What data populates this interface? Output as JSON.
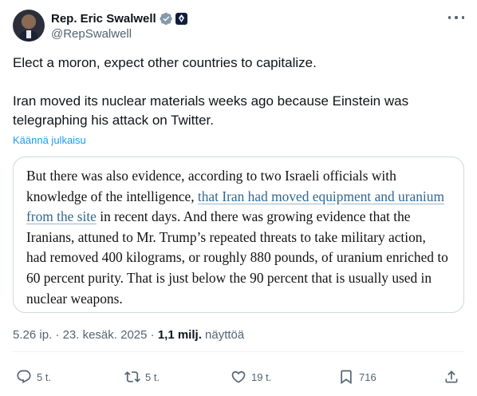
{
  "author": {
    "name": "Rep. Eric Swalwell",
    "handle": "@RepSwalwell"
  },
  "tweet": {
    "paragraph1": "Elect a moron, expect other countries to capitalize.",
    "paragraph2": "Iran moved its nuclear materials weeks ago because Einstein was telegraphing his attack on Twitter.",
    "translate_label": "Käännä julkaisu"
  },
  "quote": {
    "text_before": "But there was also evidence, according to two Israeli officials with knowledge of the intelligence, ",
    "link_text": "that Iran had moved equipment and uranium from the site",
    "text_after": " in recent days. And there was growing evidence that the Iranians, attuned to Mr. Trump’s repeated threats to take military action, had removed 400 kilograms, or roughly 880 pounds, of uranium enriched to 60 percent purity. That is just below the 90 percent that is usually used in nuclear weapons."
  },
  "meta": {
    "time": "5.26 ip.",
    "separator": "·",
    "date": "23. kesäk. 2025",
    "views": "1,1 milj.",
    "views_label": "näyttöä"
  },
  "actions": {
    "replies": "5 t.",
    "reposts": "5 t.",
    "likes": "19 t.",
    "bookmarks": "716"
  },
  "colors": {
    "text": "#0f1419",
    "secondary": "#536471",
    "link": "#1d9bf0",
    "quote_link": "#326891",
    "verified": "#829aab",
    "border": "#cfd9de"
  },
  "icons": {
    "more": "more-dots-icon",
    "verified": "verified-badge-icon",
    "government": "government-badge-icon",
    "reply": "reply-icon",
    "repost": "repost-icon",
    "like": "heart-icon",
    "bookmark": "bookmark-icon",
    "share": "share-icon"
  }
}
